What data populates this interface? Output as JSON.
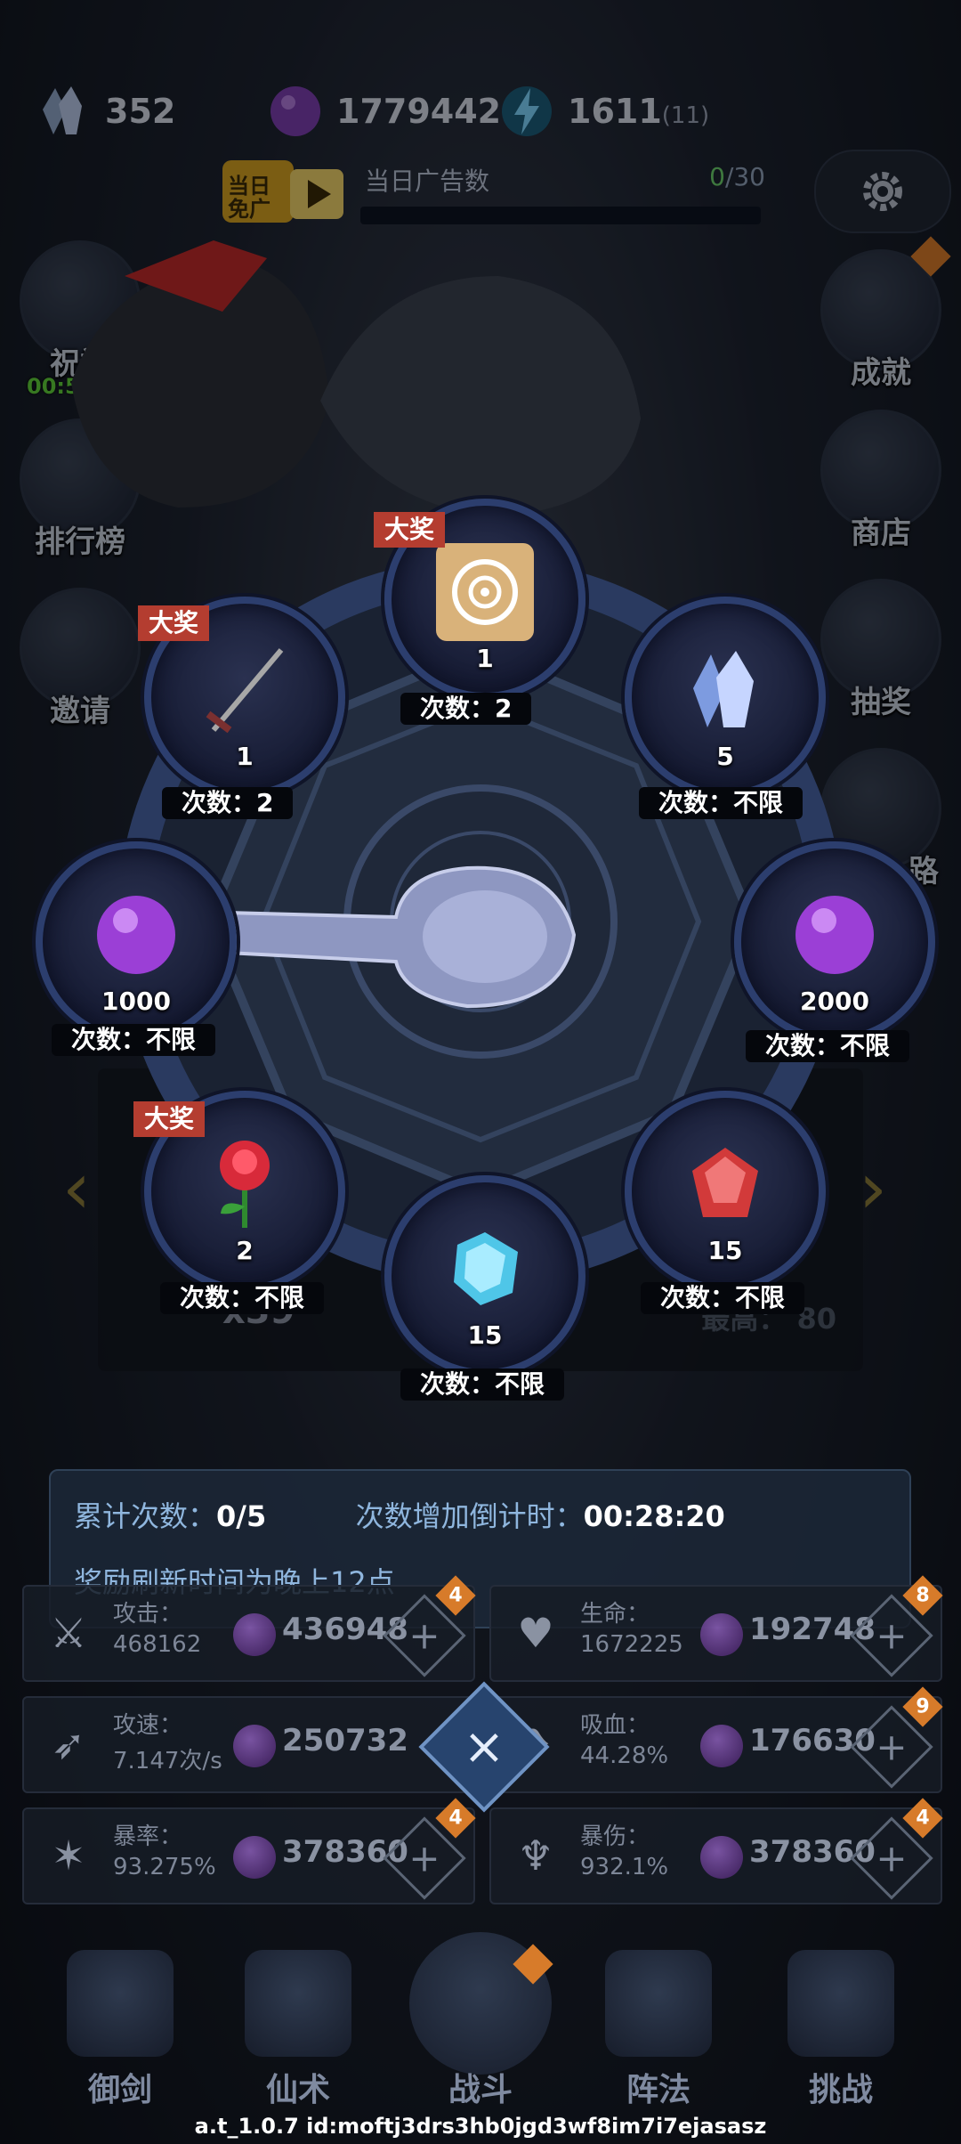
{
  "currencies": [
    {
      "icon": "crystal-icon",
      "value": "352"
    },
    {
      "icon": "purple-orb-icon",
      "value": "1779442"
    },
    {
      "icon": "energy-icon",
      "value": "1611",
      "sub": "(11)"
    }
  ],
  "ad": {
    "badge": "当日免广",
    "label": "当日广告数",
    "count_done": "0",
    "count_total": "/30",
    "progress": 0
  },
  "side_left": [
    {
      "id": "bless",
      "label": "祝福",
      "timer": "00:57:28"
    },
    {
      "id": "ranking",
      "label": "排行榜"
    },
    {
      "id": "invite",
      "label": "邀请"
    }
  ],
  "side_right": [
    {
      "id": "achievement",
      "label": "成就"
    },
    {
      "id": "shop",
      "label": "商店"
    },
    {
      "id": "lottery",
      "label": "抽奖"
    },
    {
      "id": "road",
      "label": "路"
    }
  ],
  "wheel": {
    "big_prize_label": "大奖",
    "slots": [
      {
        "id": "top",
        "item": "target-token-icon",
        "amount": "1",
        "count": "次数：2",
        "big": true
      },
      {
        "id": "upper-right",
        "item": "crystal-icon",
        "amount": "5",
        "count": "次数：不限",
        "big": false
      },
      {
        "id": "right",
        "item": "purple-orb-icon",
        "amount": "2000",
        "count": "次数：不限",
        "big": false
      },
      {
        "id": "lower-right",
        "item": "red-gem-icon",
        "amount": "15",
        "count": "次数：不限",
        "big": false
      },
      {
        "id": "bottom",
        "item": "blue-gem-icon",
        "amount": "15",
        "count": "次数：不限",
        "big": false
      },
      {
        "id": "lower-left",
        "item": "rose-icon",
        "amount": "2",
        "count": "次数：不限",
        "big": true
      },
      {
        "id": "left",
        "item": "purple-orb-icon",
        "amount": "1000",
        "count": "次数：不限",
        "big": false
      },
      {
        "id": "upper-left",
        "item": "sword-icon",
        "amount": "1",
        "count": "次数：2",
        "big": true
      }
    ]
  },
  "behind": {
    "count": "x39",
    "best": "最高： 80"
  },
  "info": {
    "total_label": "累计次数：",
    "total_value": "0/5",
    "countdown_label": "次数增加倒计时：",
    "countdown_value": "00:28:20",
    "refresh_note": "奖励刷新时间为晚上12点"
  },
  "stats": [
    {
      "name": "攻击：",
      "value": "468162",
      "cost": "436948",
      "badge": "4",
      "icon": "attack-icon"
    },
    {
      "name": "生命：",
      "value": "1672225",
      "cost": "192748",
      "badge": "8",
      "icon": "heart-icon"
    },
    {
      "name": "攻速：",
      "value": "7.147次/s",
      "cost": "250732",
      "badge": "",
      "icon": "speed-icon"
    },
    {
      "name": "吸血：",
      "value": "44.28%",
      "cost": "176630",
      "badge": "9",
      "icon": "lifesteal-icon"
    },
    {
      "name": "暴率：",
      "value": "93.275%",
      "cost": "378360",
      "badge": "4",
      "icon": "crit-rate-icon"
    },
    {
      "name": "暴伤：",
      "value": "932.1%",
      "cost": "378360",
      "badge": "4",
      "icon": "crit-damage-icon"
    }
  ],
  "nav": [
    {
      "id": "sword",
      "label": "御剑"
    },
    {
      "id": "spell",
      "label": "仙术"
    },
    {
      "id": "battle",
      "label": "战斗"
    },
    {
      "id": "formation",
      "label": "阵法"
    },
    {
      "id": "challenge",
      "label": "挑战"
    }
  ],
  "version": "a.t_1.0.7 id:moftj3drs3hb0jgd3wf8im7i7ejasasz",
  "colors": {
    "accent_green": "#6ccf6c",
    "prize_red": "#b43d30",
    "panel_blue": "#8fb6de"
  }
}
